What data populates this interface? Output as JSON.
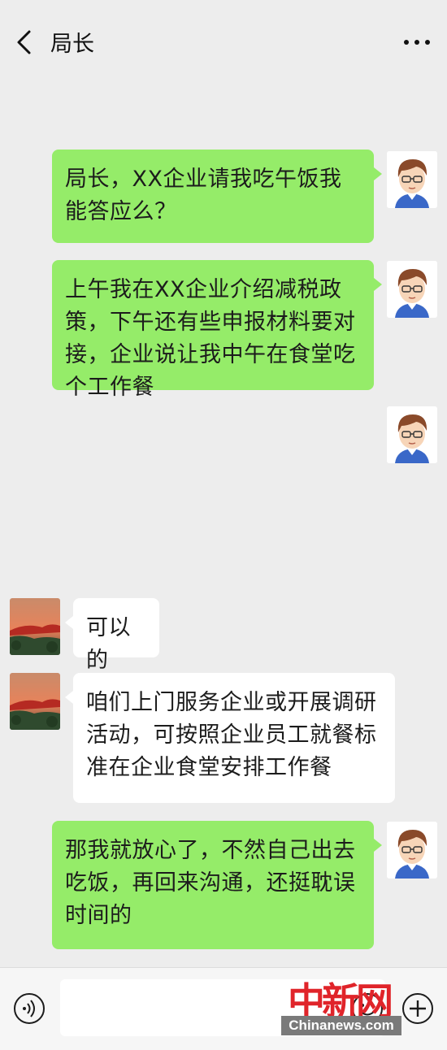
{
  "header": {
    "back_icon": "chevron-left-icon",
    "title": "局长",
    "more_icon": "ellipsis-icon"
  },
  "messages": [
    {
      "sender": "me",
      "text": "局长，XX企业请我吃午饭我能答应么？"
    },
    {
      "sender": "me",
      "text": "上午我在XX企业介绍减税政策，下午还有些申报材料要对接，企业说让我中午在食堂吃个工作餐"
    },
    {
      "sender": "me",
      "text": ""
    },
    {
      "sender": "boss",
      "text": "可以的"
    },
    {
      "sender": "boss",
      "text": "咱们上门服务企业或开展调研活动，可按照企业员工就餐标准在企业食堂安排工作餐"
    },
    {
      "sender": "me",
      "text": "那我就放心了，不然自己出去吃饭，再回来沟通，还挺耽误时间的"
    }
  ],
  "input_bar": {
    "voice_icon": "voice-icon",
    "input_value": "",
    "emoji_icon": "emoji-icon",
    "add_icon": "plus-circle-icon"
  },
  "watermark": {
    "logo_text": "中新网",
    "url": "Chinanews.com"
  },
  "colors": {
    "background": "#ededed",
    "my_bubble": "#95ec69",
    "other_bubble": "#ffffff",
    "watermark_red": "#e0242a"
  }
}
